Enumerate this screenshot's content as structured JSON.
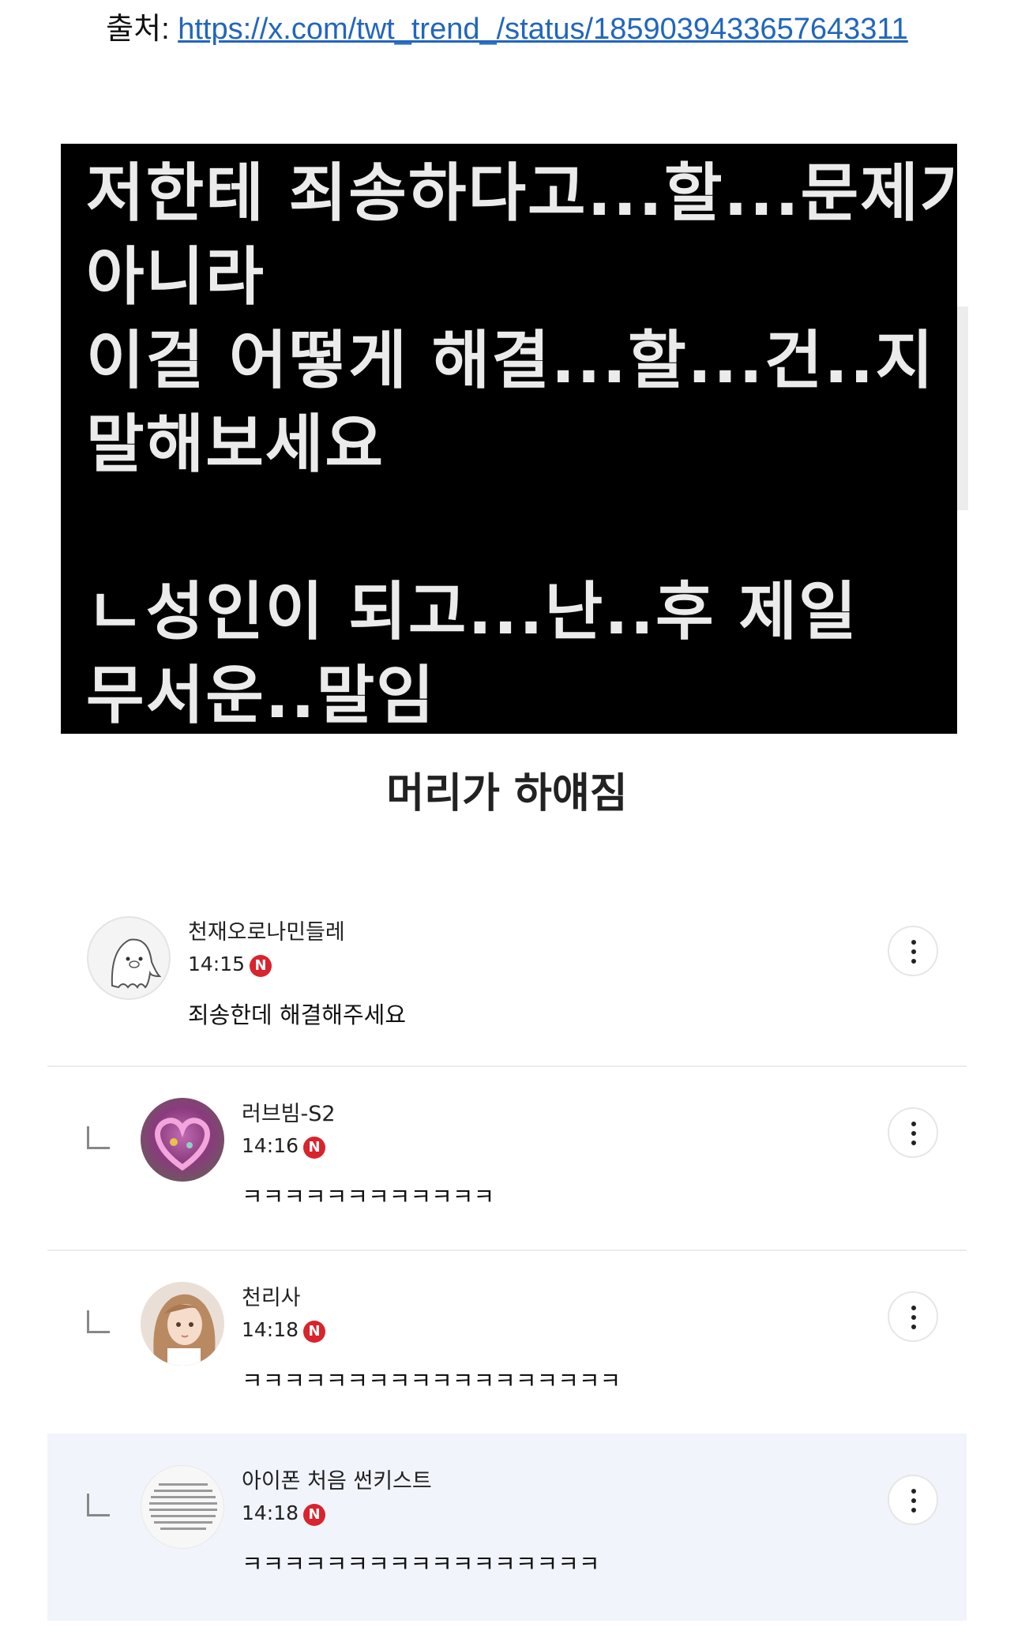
{
  "source": {
    "label": "출처:",
    "url": "https://x.com/twt_trend_/status/1859039433657643311"
  },
  "meme": {
    "lines": [
      "저한테 죄송하다고...할...문제가",
      "아니라",
      "이걸 어떻게 해결...할...건..지",
      "말해보세요",
      "ㄴ성인이 되고...난..후 제일",
      "무서운..말임"
    ]
  },
  "caption": "머리가 하얘짐",
  "comments": [
    {
      "nickname": "천재오로나민들레",
      "time": "14:15",
      "badge": "N",
      "text": "죄송한데 해결해주세요",
      "is_reply": false,
      "avatar": "pig-ghost-avatar"
    },
    {
      "nickname": "러브빔-S2",
      "time": "14:16",
      "badge": "N",
      "text": "ㅋㅋㅋㅋㅋㅋㅋㅋㅋㅋㅋㅋ",
      "is_reply": true,
      "avatar": "pink-heart-avatar"
    },
    {
      "nickname": "천리사",
      "time": "14:18",
      "badge": "N",
      "text": "ㅋㅋㅋㅋㅋㅋㅋㅋㅋㅋㅋㅋㅋㅋㅋㅋㅋㅋ",
      "is_reply": true,
      "avatar": "girl-illustration-avatar"
    },
    {
      "nickname": "아이폰 처음 썬키스트",
      "time": "14:18",
      "badge": "N",
      "text": "ㅋㅋㅋㅋㅋㅋㅋㅋㅋㅋㅋㅋㅋㅋㅋㅋㅋ",
      "is_reply": true,
      "avatar": "text-document-avatar"
    }
  ],
  "colors": {
    "link": "#2266bb",
    "badge": "#d8242d",
    "highlight_row": "#f1f4fb",
    "meme_background": "#000000",
    "meme_text": "#ebebeb"
  }
}
